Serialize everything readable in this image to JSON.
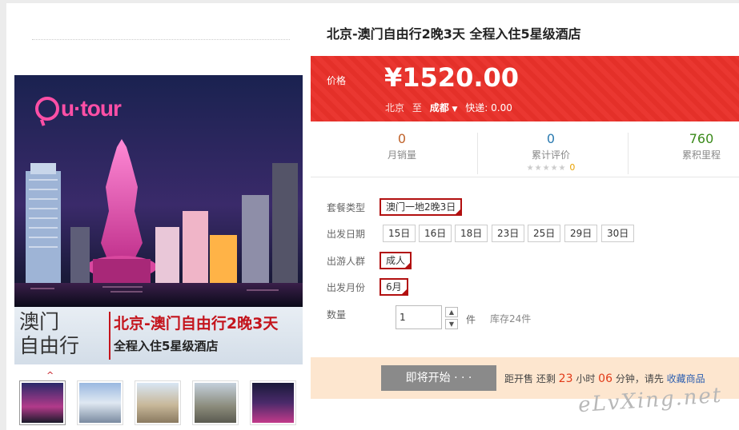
{
  "gallery": {
    "logo_text": "u·tour",
    "banner_left_line1": "澳门",
    "banner_left_line2": "自由行",
    "banner_title": "北京-澳门自由行2晚3天",
    "banner_subtitle": "全程入住5星级酒店",
    "caret": "^",
    "thumbnails": [
      "thumb-1",
      "thumb-2",
      "thumb-3",
      "thumb-4",
      "thumb-5"
    ]
  },
  "product": {
    "title": "北京-澳门自由行2晚3天 全程入住5星级酒店",
    "price_label": "价格",
    "price": "¥1520.00",
    "from_city": "北京",
    "to_word": "至",
    "to_city": "成都",
    "shipping": "快递: 0.00"
  },
  "stats": {
    "monthly_sales": {
      "value": "0",
      "label": "月销量"
    },
    "reviews": {
      "value": "0",
      "label": "累计评价",
      "stars": "★★★★★",
      "star_count": "0"
    },
    "points": {
      "value": "760",
      "label": "累积里程"
    }
  },
  "options": {
    "package_label": "套餐类型",
    "package_value": "澳门一地2晚3日",
    "date_label": "出发日期",
    "dates": [
      "15日",
      "16日",
      "18日",
      "23日",
      "25日",
      "29日",
      "30日"
    ],
    "people_label": "出游人群",
    "people_value": "成人",
    "month_label": "出发月份",
    "month_value": "6月",
    "qty_label": "数量",
    "qty_value": "1",
    "qty_unit": "件",
    "stock": "库存24件"
  },
  "buy": {
    "button_label": "即将开始 · · ·",
    "countdown_prefix": "距开售 还剩",
    "hours": "23",
    "hours_unit": "小时",
    "minutes": "06",
    "minutes_unit": "分钟，请先",
    "favorite_link": "收藏商品"
  },
  "watermark": "eLvXing.net",
  "colors": {
    "accent_red": "#e9312a",
    "selection_red": "#b20f0f",
    "buy_bar": "#fde6cf",
    "points_green": "#3a8a1a",
    "sales_orange": "#c0622a",
    "reviews_blue": "#2a7ab0"
  }
}
